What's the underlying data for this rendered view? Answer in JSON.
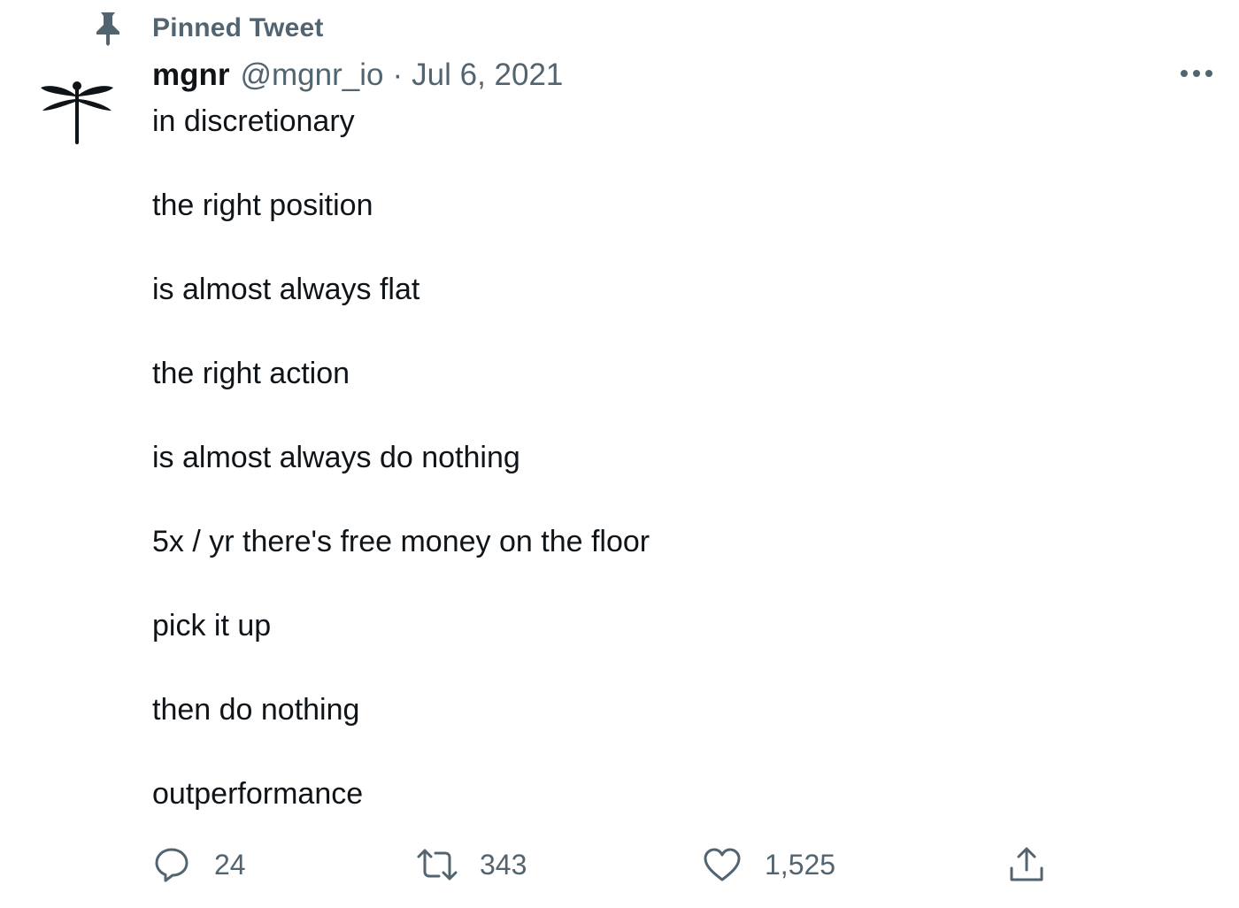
{
  "pinned": {
    "label": "Pinned Tweet",
    "icon": "pin-icon"
  },
  "author": {
    "name": "mgnr",
    "handle": "@mgnr_io",
    "separator": "·",
    "date": "Jul 6, 2021",
    "avatar_icon": "dragonfly-icon"
  },
  "more_icon": "more-options-icon",
  "tweet": {
    "lines": [
      "in discretionary",
      "the right position",
      "is almost always flat",
      "the right action",
      "is almost always do nothing",
      "5x / yr there's free money on the floor",
      "pick it up",
      "then do nothing",
      "outperformance"
    ]
  },
  "actions": {
    "replies": {
      "icon": "reply-icon",
      "count": "24"
    },
    "retweets": {
      "icon": "retweet-icon",
      "count": "343"
    },
    "likes": {
      "icon": "heart-icon",
      "count": "1,525"
    },
    "share": {
      "icon": "share-icon"
    }
  },
  "colors": {
    "text_primary": "#0f1419",
    "text_secondary": "#536471",
    "background": "#ffffff"
  }
}
